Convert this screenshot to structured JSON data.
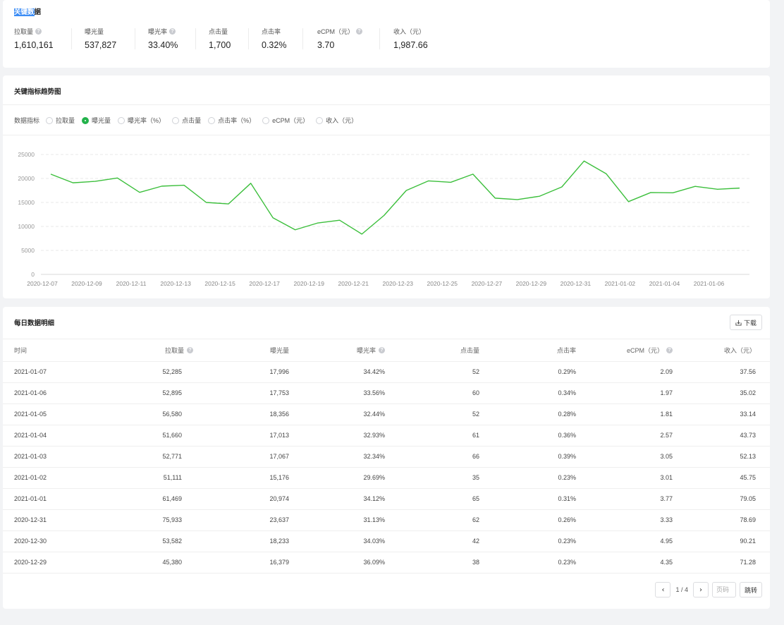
{
  "key_data": {
    "title_highlight": "关键数",
    "title_rest": "据",
    "metrics": [
      {
        "label": "拉取量",
        "value": "1,610,161",
        "help": true
      },
      {
        "label": "曝光量",
        "value": "537,827",
        "help": false
      },
      {
        "label": "曝光率",
        "value": "33.40%",
        "help": true
      },
      {
        "label": "点击量",
        "value": "1,700",
        "help": false
      },
      {
        "label": "点击率",
        "value": "0.32%",
        "help": false
      },
      {
        "label": "eCPM（元）",
        "value": "3.70",
        "help": true
      },
      {
        "label": "收入（元）",
        "value": "1,987.66",
        "help": false
      }
    ]
  },
  "trend": {
    "title": "关键指标趋势图",
    "indicator_label": "数据指标",
    "options": [
      {
        "label": "拉取量",
        "checked": false
      },
      {
        "label": "曝光量",
        "checked": true
      },
      {
        "label": "曝光率（%）",
        "checked": false
      },
      {
        "label": "点击量",
        "checked": false
      },
      {
        "label": "点击率（%）",
        "checked": false
      },
      {
        "label": "eCPM（元）",
        "checked": false
      },
      {
        "label": "收入（元）",
        "checked": false
      }
    ]
  },
  "chart_data": {
    "type": "line",
    "x": [
      "2020-12-07",
      "2020-12-08",
      "2020-12-09",
      "2020-12-10",
      "2020-12-11",
      "2020-12-12",
      "2020-12-13",
      "2020-12-14",
      "2020-12-15",
      "2020-12-16",
      "2020-12-17",
      "2020-12-18",
      "2020-12-19",
      "2020-12-20",
      "2020-12-21",
      "2020-12-22",
      "2020-12-23",
      "2020-12-24",
      "2020-12-25",
      "2020-12-26",
      "2020-12-27",
      "2020-12-28",
      "2020-12-29",
      "2020-12-30",
      "2020-12-31",
      "2021-01-01",
      "2021-01-02",
      "2021-01-03",
      "2021-01-04",
      "2021-01-05",
      "2021-01-06",
      "2021-01-07"
    ],
    "x_tick_labels": [
      "2020-12-07",
      "2020-12-09",
      "2020-12-11",
      "2020-12-13",
      "2020-12-15",
      "2020-12-17",
      "2020-12-19",
      "2020-12-21",
      "2020-12-23",
      "2020-12-25",
      "2020-12-27",
      "2020-12-29",
      "2020-12-31",
      "2021-01-02",
      "2021-01-04",
      "2021-01-06"
    ],
    "series": [
      {
        "values": [
          20900,
          19100,
          19400,
          20100,
          17100,
          18400,
          18600,
          15000,
          14700,
          19000,
          11800,
          9300,
          10700,
          11300,
          8400,
          12300,
          17500,
          19500,
          19200,
          20900,
          15900,
          15600,
          16300,
          18233,
          23637,
          20974,
          15176,
          17067,
          17013,
          18356,
          17753,
          17996
        ]
      }
    ],
    "ylim": [
      0,
      25000
    ],
    "yticks": [
      0,
      5000,
      10000,
      15000,
      20000,
      25000
    ],
    "grid": true,
    "line_color": "#3cbf3c"
  },
  "daily": {
    "title": "每日数据明细",
    "download_label": "下载",
    "columns": [
      {
        "label": "时间",
        "help": false
      },
      {
        "label": "拉取量",
        "help": true
      },
      {
        "label": "曝光量",
        "help": false
      },
      {
        "label": "曝光率",
        "help": true
      },
      {
        "label": "点击量",
        "help": false
      },
      {
        "label": "点击率",
        "help": false
      },
      {
        "label": "eCPM（元）",
        "help": true
      },
      {
        "label": "收入（元）",
        "help": false
      }
    ],
    "rows": [
      [
        "2021-01-07",
        "52,285",
        "17,996",
        "34.42%",
        "52",
        "0.29%",
        "2.09",
        "37.56"
      ],
      [
        "2021-01-06",
        "52,895",
        "17,753",
        "33.56%",
        "60",
        "0.34%",
        "1.97",
        "35.02"
      ],
      [
        "2021-01-05",
        "56,580",
        "18,356",
        "32.44%",
        "52",
        "0.28%",
        "1.81",
        "33.14"
      ],
      [
        "2021-01-04",
        "51,660",
        "17,013",
        "32.93%",
        "61",
        "0.36%",
        "2.57",
        "43.73"
      ],
      [
        "2021-01-03",
        "52,771",
        "17,067",
        "32.34%",
        "66",
        "0.39%",
        "3.05",
        "52.13"
      ],
      [
        "2021-01-02",
        "51,111",
        "15,176",
        "29.69%",
        "35",
        "0.23%",
        "3.01",
        "45.75"
      ],
      [
        "2021-01-01",
        "61,469",
        "20,974",
        "34.12%",
        "65",
        "0.31%",
        "3.77",
        "79.05"
      ],
      [
        "2020-12-31",
        "75,933",
        "23,637",
        "31.13%",
        "62",
        "0.26%",
        "3.33",
        "78.69"
      ],
      [
        "2020-12-30",
        "53,582",
        "18,233",
        "34.03%",
        "42",
        "0.23%",
        "4.95",
        "90.21"
      ],
      [
        "2020-12-29",
        "45,380",
        "16,379",
        "36.09%",
        "38",
        "0.23%",
        "4.35",
        "71.28"
      ]
    ],
    "pager": {
      "prev": "‹",
      "next": "›",
      "page_text": "1 / 4",
      "input_placeholder": "页码",
      "jump_label": "跳转"
    }
  }
}
